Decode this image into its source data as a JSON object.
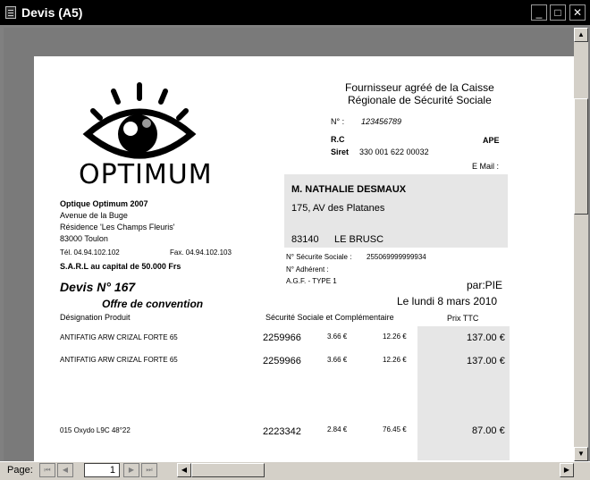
{
  "window": {
    "title": "Devis (A5)",
    "minimize": "_",
    "maximize": "□",
    "close": "✕"
  },
  "supplier_header": {
    "line1": "Fournisseur agréé de la Caisse",
    "line2": "Régionale de Sécurité Sociale"
  },
  "ids": {
    "no_label": "N° :",
    "no_value": "123456789",
    "rc_label": "R.C",
    "ape_label": "APE",
    "siret_label": "Siret",
    "siret_value": "330 001 622 00032",
    "email_label": "E Mail :"
  },
  "logo": {
    "text": "OPTIMUM"
  },
  "company": {
    "name": "Optique Optimum 2007",
    "address1": "Avenue de la Buge",
    "address2": "Résidence 'Les Champs Fleuris'",
    "city": "83000 Toulon",
    "phone": "Tél. 04.94.102.102",
    "fax": "Fax. 04.94.102.103",
    "capital": "S.A.R.L au capital de 50.000 Frs"
  },
  "customer": {
    "name": "M. NATHALIE DESMAUX",
    "address": "175, AV des Platanes",
    "postcode": "83140",
    "city": "LE BRUSC",
    "secu_label": "N° Sécurite Sociale :",
    "secu_value": "255069999999934",
    "adherent_label": "N° Adhérent :",
    "agf": "A.G.F. - TYPE 1"
  },
  "quote": {
    "title": "Devis N° 167",
    "subtitle": "Offre de convention",
    "author": "par:PIE",
    "date": "Le lundi 8 mars 2010"
  },
  "table": {
    "headers": {
      "designation": "Désignation Produit",
      "secu": "Sécurité Sociale et Complémentaire",
      "price": "Prix TTC"
    },
    "rows": [
      {
        "designation": "ANTIFATIG ARW CRIZAL FORTE 65",
        "code": "2259966",
        "secu": "3.66 €",
        "comp": "12.26 €",
        "price": "137.00 €"
      },
      {
        "designation": "ANTIFATIG ARW CRIZAL FORTE 65",
        "code": "2259966",
        "secu": "3.66 €",
        "comp": "12.26 €",
        "price": "137.00 €"
      },
      {
        "designation": "015 Oxydo L9C 48°22",
        "code": "2223342",
        "secu": "2.84 €",
        "comp": "76.45 €",
        "price": "87.00 €"
      }
    ]
  },
  "pager": {
    "label": "Page:",
    "current": "1",
    "first": "⏮",
    "prev": "◀",
    "next": "▶",
    "last": "⏭"
  },
  "scroll": {
    "up": "▲",
    "down": "▼",
    "left": "◀",
    "right": "▶"
  }
}
